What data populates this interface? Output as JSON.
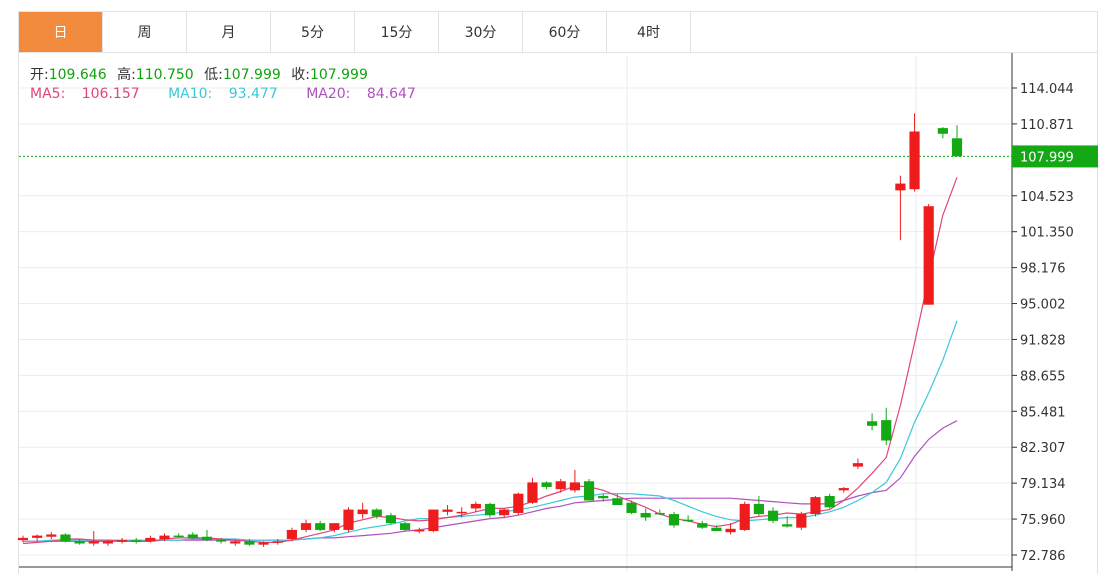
{
  "tabs": [
    {
      "label": "日",
      "active": true
    },
    {
      "label": "周",
      "active": false
    },
    {
      "label": "月",
      "active": false
    },
    {
      "label": "5分",
      "active": false
    },
    {
      "label": "15分",
      "active": false
    },
    {
      "label": "30分",
      "active": false
    },
    {
      "label": "60分",
      "active": false
    },
    {
      "label": "4时",
      "active": false
    }
  ],
  "info": {
    "open_label": "开:",
    "open": "109.646",
    "high_label": "高:",
    "high": "110.750",
    "low_label": "低:",
    "low": "107.999",
    "close_label": "收:",
    "close": "107.999",
    "ma5_label": "MA5:",
    "ma5": "106.157",
    "ma10_label": "MA10:",
    "ma10": "93.477",
    "ma20_label": "MA20:",
    "ma20": "84.647"
  },
  "colors": {
    "up": "#ee1c1c",
    "down": "#14a814",
    "ma5": "#e0457b",
    "ma10": "#3cc8d8",
    "ma20": "#b050c0",
    "active_tab": "#f28b3e",
    "price_tag": "#14a814"
  },
  "chart_data": {
    "type": "candlestick",
    "y_ticks": [
      "114.044",
      "110.871",
      "107.999",
      "104.523",
      "101.350",
      "98.176",
      "95.002",
      "91.828",
      "88.655",
      "85.481",
      "82.307",
      "79.134",
      "75.960",
      "72.786"
    ],
    "ylim": [
      72.786,
      114.044
    ],
    "last_price": "107.999",
    "candles": [
      [
        74.1,
        74.5,
        73.9,
        74.3
      ],
      [
        74.3,
        74.6,
        74.0,
        74.5
      ],
      [
        74.4,
        74.8,
        74.2,
        74.6
      ],
      [
        74.6,
        74.7,
        73.9,
        74.0
      ],
      [
        74.0,
        74.2,
        73.7,
        73.8
      ],
      [
        73.8,
        74.9,
        73.6,
        74.0
      ],
      [
        73.8,
        74.1,
        73.6,
        74.0
      ],
      [
        74.0,
        74.3,
        73.8,
        74.1
      ],
      [
        74.1,
        74.3,
        73.8,
        74.0
      ],
      [
        74.0,
        74.5,
        73.9,
        74.3
      ],
      [
        74.2,
        74.7,
        74.0,
        74.5
      ],
      [
        74.5,
        74.7,
        74.3,
        74.4
      ],
      [
        74.6,
        74.8,
        74.2,
        74.3
      ],
      [
        74.4,
        75.0,
        74.0,
        74.1
      ],
      [
        74.1,
        74.3,
        73.8,
        74.0
      ],
      [
        73.8,
        74.1,
        73.6,
        74.0
      ],
      [
        74.0,
        74.2,
        73.6,
        73.7
      ],
      [
        73.7,
        74.0,
        73.5,
        73.9
      ],
      [
        73.9,
        74.2,
        73.7,
        74.0
      ],
      [
        74.2,
        75.2,
        74.0,
        75.0
      ],
      [
        75.0,
        75.9,
        74.8,
        75.6
      ],
      [
        75.6,
        75.8,
        74.9,
        75.0
      ],
      [
        75.0,
        75.6,
        74.8,
        75.6
      ],
      [
        75.0,
        77.0,
        74.8,
        76.8
      ],
      [
        76.4,
        77.4,
        76.0,
        76.8
      ],
      [
        76.8,
        76.9,
        76.0,
        76.2
      ],
      [
        76.3,
        76.5,
        75.5,
        75.6
      ],
      [
        75.6,
        75.7,
        74.9,
        75.0
      ],
      [
        74.9,
        75.2,
        74.7,
        75.0
      ],
      [
        74.9,
        76.8,
        74.8,
        76.8
      ],
      [
        76.6,
        77.2,
        76.3,
        76.8
      ],
      [
        76.6,
        77.0,
        76.1,
        76.6
      ],
      [
        76.9,
        77.5,
        76.6,
        77.3
      ],
      [
        77.3,
        77.4,
        76.1,
        76.3
      ],
      [
        76.3,
        76.9,
        76.1,
        76.8
      ],
      [
        76.5,
        78.3,
        76.3,
        78.2
      ],
      [
        77.4,
        79.6,
        77.3,
        79.2
      ],
      [
        79.2,
        79.3,
        78.6,
        78.8
      ],
      [
        78.6,
        79.5,
        78.3,
        79.3
      ],
      [
        78.5,
        80.3,
        78.3,
        79.2
      ],
      [
        79.3,
        79.5,
        77.6,
        77.6
      ],
      [
        78.0,
        78.2,
        77.5,
        77.8
      ],
      [
        77.8,
        78.2,
        77.3,
        77.2
      ],
      [
        77.4,
        77.6,
        76.4,
        76.5
      ],
      [
        76.5,
        76.9,
        75.8,
        76.1
      ],
      [
        76.5,
        76.8,
        76.3,
        76.4
      ],
      [
        76.4,
        76.6,
        75.2,
        75.4
      ],
      [
        75.9,
        76.3,
        75.7,
        75.8
      ],
      [
        75.6,
        75.8,
        75.1,
        75.2
      ],
      [
        75.2,
        75.4,
        74.9,
        74.9
      ],
      [
        74.8,
        75.6,
        74.6,
        75.1
      ],
      [
        75.0,
        77.5,
        74.9,
        77.3
      ],
      [
        77.3,
        78.0,
        76.2,
        76.4
      ],
      [
        76.7,
        77.0,
        75.6,
        75.8
      ],
      [
        75.5,
        76.2,
        75.2,
        75.3
      ],
      [
        75.2,
        76.6,
        75.0,
        76.4
      ],
      [
        76.4,
        78.0,
        76.2,
        77.9
      ],
      [
        78.0,
        78.2,
        76.9,
        77.0
      ],
      [
        78.5,
        78.8,
        78.3,
        78.7
      ],
      [
        80.6,
        81.3,
        80.4,
        80.9
      ],
      [
        84.6,
        85.3,
        83.8,
        84.2
      ],
      [
        84.7,
        85.8,
        82.5,
        82.9
      ],
      [
        105.0,
        106.3,
        100.6,
        105.6
      ],
      [
        105.1,
        111.8,
        104.9,
        110.2
      ],
      [
        94.9,
        103.8,
        94.9,
        103.6
      ],
      [
        110.5,
        110.6,
        109.6,
        110.0
      ],
      [
        109.6,
        110.75,
        107.999,
        107.999
      ]
    ],
    "ma5": [
      73.8,
      73.9,
      74.0,
      74.2,
      74.2,
      74.1,
      74.1,
      74.0,
      74.0,
      74.0,
      74.2,
      74.3,
      74.3,
      74.3,
      74.2,
      74.1,
      74.0,
      73.9,
      73.9,
      74.1,
      74.4,
      74.7,
      75.0,
      75.6,
      75.9,
      76.2,
      76.1,
      75.9,
      75.8,
      75.9,
      76.1,
      76.3,
      76.6,
      76.9,
      76.9,
      77.1,
      77.5,
      78.0,
      78.4,
      78.9,
      78.8,
      78.5,
      78.0,
      77.5,
      77.0,
      76.4,
      76.0,
      75.8,
      75.5,
      75.3,
      75.5,
      76.0,
      76.2,
      76.3,
      76.5,
      76.4,
      76.6,
      76.8,
      77.6,
      78.7,
      80.0,
      81.4,
      86.0,
      91.5,
      97.3,
      102.8,
      106.157
    ],
    "ma10": [
      74.0,
      74.0,
      74.1,
      74.1,
      74.1,
      74.1,
      74.1,
      74.1,
      74.1,
      74.1,
      74.1,
      74.1,
      74.2,
      74.2,
      74.2,
      74.2,
      74.1,
      74.1,
      74.1,
      74.1,
      74.2,
      74.3,
      74.5,
      74.8,
      75.1,
      75.3,
      75.5,
      75.8,
      76.0,
      76.0,
      76.1,
      76.2,
      76.3,
      76.4,
      76.6,
      76.8,
      77.0,
      77.3,
      77.6,
      77.9,
      78.0,
      78.2,
      78.2,
      78.2,
      78.1,
      78.0,
      77.6,
      77.1,
      76.6,
      76.2,
      75.9,
      75.8,
      75.9,
      76.0,
      76.1,
      76.1,
      76.3,
      76.6,
      77.0,
      77.6,
      78.3,
      79.2,
      81.3,
      84.5,
      87.1,
      90.0,
      93.477
    ],
    "ma20": [
      74.0,
      74.0,
      74.0,
      74.0,
      74.0,
      74.0,
      74.0,
      74.0,
      74.0,
      74.0,
      74.1,
      74.1,
      74.1,
      74.1,
      74.1,
      74.1,
      74.1,
      74.1,
      74.1,
      74.1,
      74.2,
      74.3,
      74.3,
      74.4,
      74.5,
      74.6,
      74.7,
      74.9,
      75.0,
      75.2,
      75.4,
      75.6,
      75.8,
      76.0,
      76.1,
      76.3,
      76.6,
      76.9,
      77.1,
      77.4,
      77.5,
      77.6,
      77.7,
      77.8,
      77.8,
      77.8,
      77.8,
      77.8,
      77.8,
      77.8,
      77.8,
      77.7,
      77.6,
      77.5,
      77.4,
      77.3,
      77.3,
      77.3,
      77.6,
      78.0,
      78.3,
      78.5,
      79.6,
      81.5,
      83.0,
      84.0,
      84.647
    ]
  }
}
